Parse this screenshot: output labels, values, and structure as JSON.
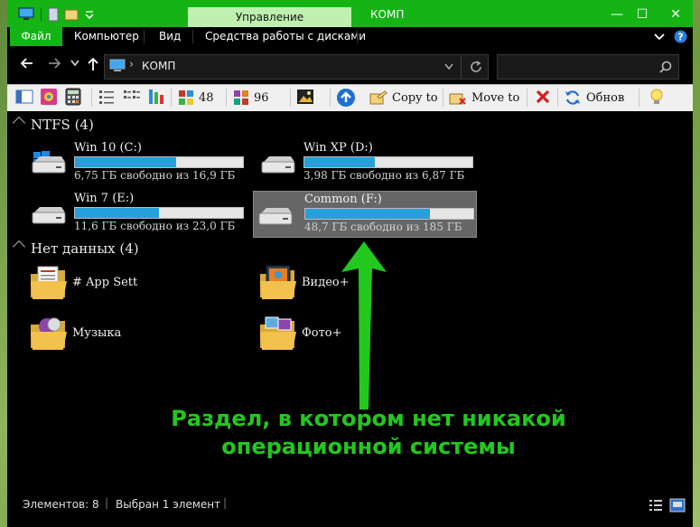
{
  "titlebar": {
    "context_tab": "Управление",
    "title": "КОМП",
    "minimize": "—",
    "maximize": "☐",
    "close": "✕",
    "accent": "#14b414"
  },
  "menu": {
    "items": [
      "Файл",
      "Компьютер",
      "Вид",
      "Средства работы с дисками"
    ]
  },
  "address": {
    "path_label": "КОМП",
    "separator": "›"
  },
  "toolbar": {
    "view48": "48",
    "view96": "96",
    "copy_to": "Copy to",
    "move_to": "Move to",
    "refresh": "Обнов"
  },
  "groups": {
    "ntfs": "NTFS (4)",
    "nodata": "Нет данных (4)"
  },
  "drives": [
    {
      "name": "Win 10 (C:)",
      "free": "6,75 ГБ свободно из 16,9 ГБ",
      "used_fraction": 0.6
    },
    {
      "name": "Win XP (D:)",
      "free": "3,98 ГБ свободно из 6,87 ГБ",
      "used_fraction": 0.42
    },
    {
      "name": "Win 7 (E:)",
      "free": "11,6 ГБ свободно из 23,0 ГБ",
      "used_fraction": 0.5
    },
    {
      "name": "Common (F:)",
      "free": "48,7 ГБ свободно из 185 ГБ",
      "used_fraction": 0.74
    }
  ],
  "folders": [
    {
      "name": "# App Sett",
      "icon": "folder-docs-icon"
    },
    {
      "name": "Видео+",
      "icon": "folder-video-icon"
    },
    {
      "name": "Музыка",
      "icon": "folder-music-icon"
    },
    {
      "name": "Фото+",
      "icon": "folder-photo-icon"
    }
  ],
  "annotation": {
    "line1": "Раздел, в котором нет никакой",
    "line2": "операционной системы",
    "color": "#22c81e"
  },
  "status": {
    "count": "Элементов: 8",
    "selected": "Выбран 1 элемент"
  }
}
